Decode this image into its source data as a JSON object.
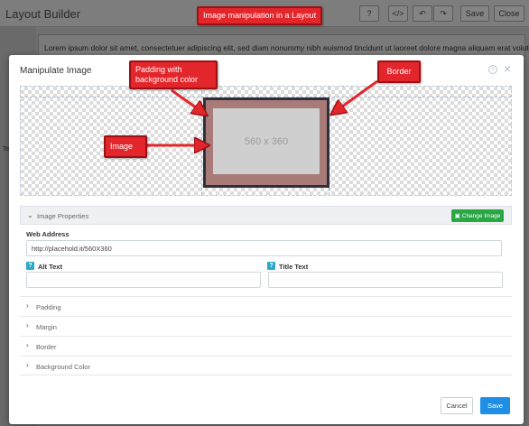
{
  "app": {
    "title": "Layout Builder",
    "help_label": "?",
    "code_label": "</>",
    "undo_icon": "undo-icon",
    "redo_icon": "redo-icon",
    "save_label": "Save",
    "close_label": "Close",
    "sidebar_label": "Te",
    "content_text": "Lorem ipsum dolor sit amet, consectetuer adipiscing elit, sed diam nonummy nibh euismod tincidunt ut laoreet dolore magna aliquam erat volutpat. Ut"
  },
  "modal": {
    "title": "Manipulate Image",
    "help_label": "?",
    "close_label": "×",
    "preview": {
      "placeholder_text": "560 x 360",
      "padding_color": "#a97b78",
      "border_color": "#2d2f3a"
    },
    "image_properties": {
      "header": "Image Properties",
      "change_button": "Change Image",
      "web_address_label": "Web Address",
      "web_address_value": "http://placehold.it/560X360",
      "alt_text_label": "Alt Text",
      "title_text_label": "Title Text",
      "badge": "?"
    },
    "sections": [
      {
        "label": "Padding"
      },
      {
        "label": "Margin"
      },
      {
        "label": "Border"
      },
      {
        "label": "Background Color"
      }
    ],
    "buttons": {
      "cancel": "Cancel",
      "save": "Save"
    }
  },
  "annotations": {
    "top": "Image manipulation in a Layout",
    "padding": "Padding with background color",
    "border": "Border",
    "image": "Image",
    "callout_color": "#e3262b"
  }
}
